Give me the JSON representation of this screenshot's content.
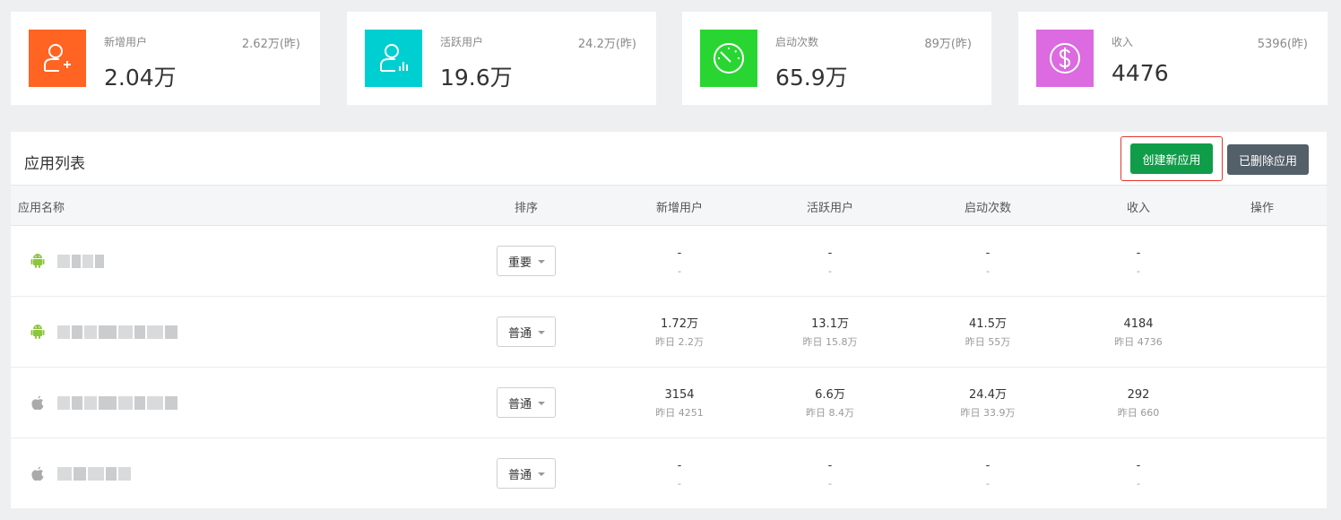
{
  "stats": [
    {
      "label": "新增用户",
      "value": "2.04万",
      "prev": "2.62万(昨)",
      "color": "#ff6422",
      "icon": "user-add-icon"
    },
    {
      "label": "活跃用户",
      "value": "19.6万",
      "prev": "24.2万(昨)",
      "color": "#00cfd1",
      "icon": "user-active-icon"
    },
    {
      "label": "启动次数",
      "value": "65.9万",
      "prev": "89万(昨)",
      "color": "#29d631",
      "icon": "speedometer-icon"
    },
    {
      "label": "收入",
      "value": "4476",
      "prev": "5396(昨)",
      "color": "#dc6ae0",
      "icon": "dollar-icon"
    }
  ],
  "panel": {
    "title": "应用列表",
    "create_label": "创建新应用",
    "deleted_label": "已删除应用"
  },
  "table": {
    "headers": {
      "name": "应用名称",
      "sort": "排序",
      "new_users": "新增用户",
      "active_users": "活跃用户",
      "launches": "启动次数",
      "revenue": "收入",
      "actions": "操作"
    },
    "rows": [
      {
        "platform": "android-icon",
        "priority": "重要",
        "new_users": "-",
        "new_users_prev": "-",
        "active_users": "-",
        "active_users_prev": "-",
        "launches": "-",
        "launches_prev": "-",
        "revenue": "-",
        "revenue_prev": "-"
      },
      {
        "platform": "android-icon",
        "priority": "普通",
        "new_users": "1.72万",
        "new_users_prev": "昨日 2.2万",
        "active_users": "13.1万",
        "active_users_prev": "昨日 15.8万",
        "launches": "41.5万",
        "launches_prev": "昨日 55万",
        "revenue": "4184",
        "revenue_prev": "昨日 4736"
      },
      {
        "platform": "apple-icon",
        "priority": "普通",
        "new_users": "3154",
        "new_users_prev": "昨日 4251",
        "active_users": "6.6万",
        "active_users_prev": "昨日 8.4万",
        "launches": "24.4万",
        "launches_prev": "昨日 33.9万",
        "revenue": "292",
        "revenue_prev": "昨日 660"
      },
      {
        "platform": "apple-icon",
        "priority": "普通",
        "new_users": "-",
        "new_users_prev": "-",
        "active_users": "-",
        "active_users_prev": "-",
        "launches": "-",
        "launches_prev": "-",
        "revenue": "-",
        "revenue_prev": "-"
      }
    ]
  },
  "colors": {
    "create_button": "#0f9d49",
    "deleted_button": "#535f69",
    "highlight_border": "#e0362e",
    "android": "#8cc63f",
    "apple": "#aaaaaa"
  }
}
